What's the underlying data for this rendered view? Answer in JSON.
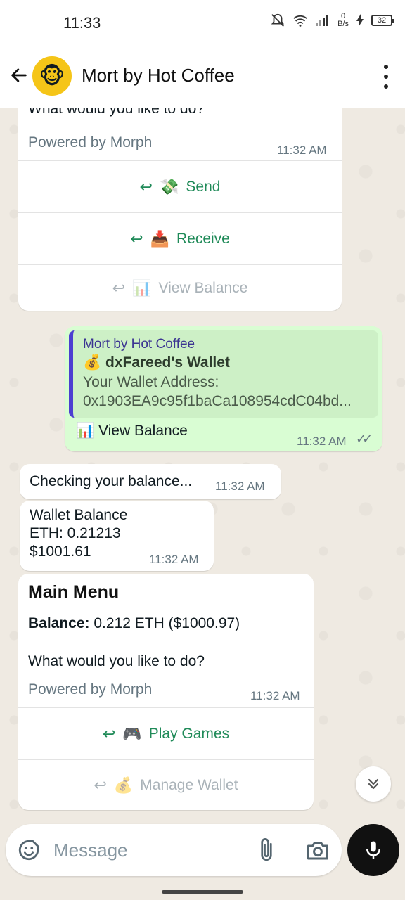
{
  "status_bar": {
    "time": "11:33",
    "net_speed_value": "0",
    "net_speed_unit": "B/s",
    "battery": "32"
  },
  "header": {
    "title": "Mort by Hot Coffee",
    "avatar_emoji": "🐵"
  },
  "messages": {
    "menu1": {
      "partial_text": "What would you like to do?",
      "footer": "Powered by Morph",
      "time": "11:32 AM",
      "buttons": [
        {
          "emoji": "💸",
          "label": "Send",
          "enabled": true
        },
        {
          "emoji": "📥",
          "label": "Receive",
          "enabled": true
        },
        {
          "emoji": "📊",
          "label": "View Balance",
          "enabled": false
        }
      ]
    },
    "outgoing": {
      "quote_author": "Mort by Hot Coffee",
      "quote_title_emoji": "💰",
      "quote_title": "dxFareed's Wallet",
      "quote_line1": "Your Wallet Address:",
      "quote_line2": "0x1903EA9c95f1baCa108954cdC04bd...",
      "emoji": "📊",
      "text": "View Balance",
      "time": "11:32 AM",
      "ticks": "✓✓"
    },
    "checking": {
      "text": "Checking your balance...",
      "time": "11:32 AM"
    },
    "wallet_balance": {
      "line1": "Wallet Balance",
      "line2": "ETH: 0.21213",
      "line3": "$1001.61",
      "time": "11:32 AM"
    },
    "main_menu": {
      "title": "Main Menu",
      "balance_label": "Balance:",
      "balance_value": " 0.212 ETH ($1000.97)",
      "question": "What would you like to do?",
      "footer": "Powered by Morph",
      "time": "11:32 AM",
      "buttons": [
        {
          "emoji": "🎮",
          "label": "Play Games",
          "enabled": true
        },
        {
          "emoji": "💰",
          "label": "Manage Wallet",
          "enabled": false
        }
      ]
    }
  },
  "input": {
    "placeholder": "Message"
  },
  "colors": {
    "accent_green": "#1f8a58",
    "outgoing_bubble": "#d9fdd3",
    "chat_background": "#efeae2",
    "quote_bar": "#4c3fd1"
  },
  "icons": {
    "back": "arrow-left-icon",
    "menu": "more-vert-icon",
    "emoji": "emoji-icon",
    "attach": "paperclip-icon",
    "camera": "camera-icon",
    "mic": "mic-icon",
    "scroll": "chevrons-down-icon",
    "reply": "reply-icon"
  }
}
